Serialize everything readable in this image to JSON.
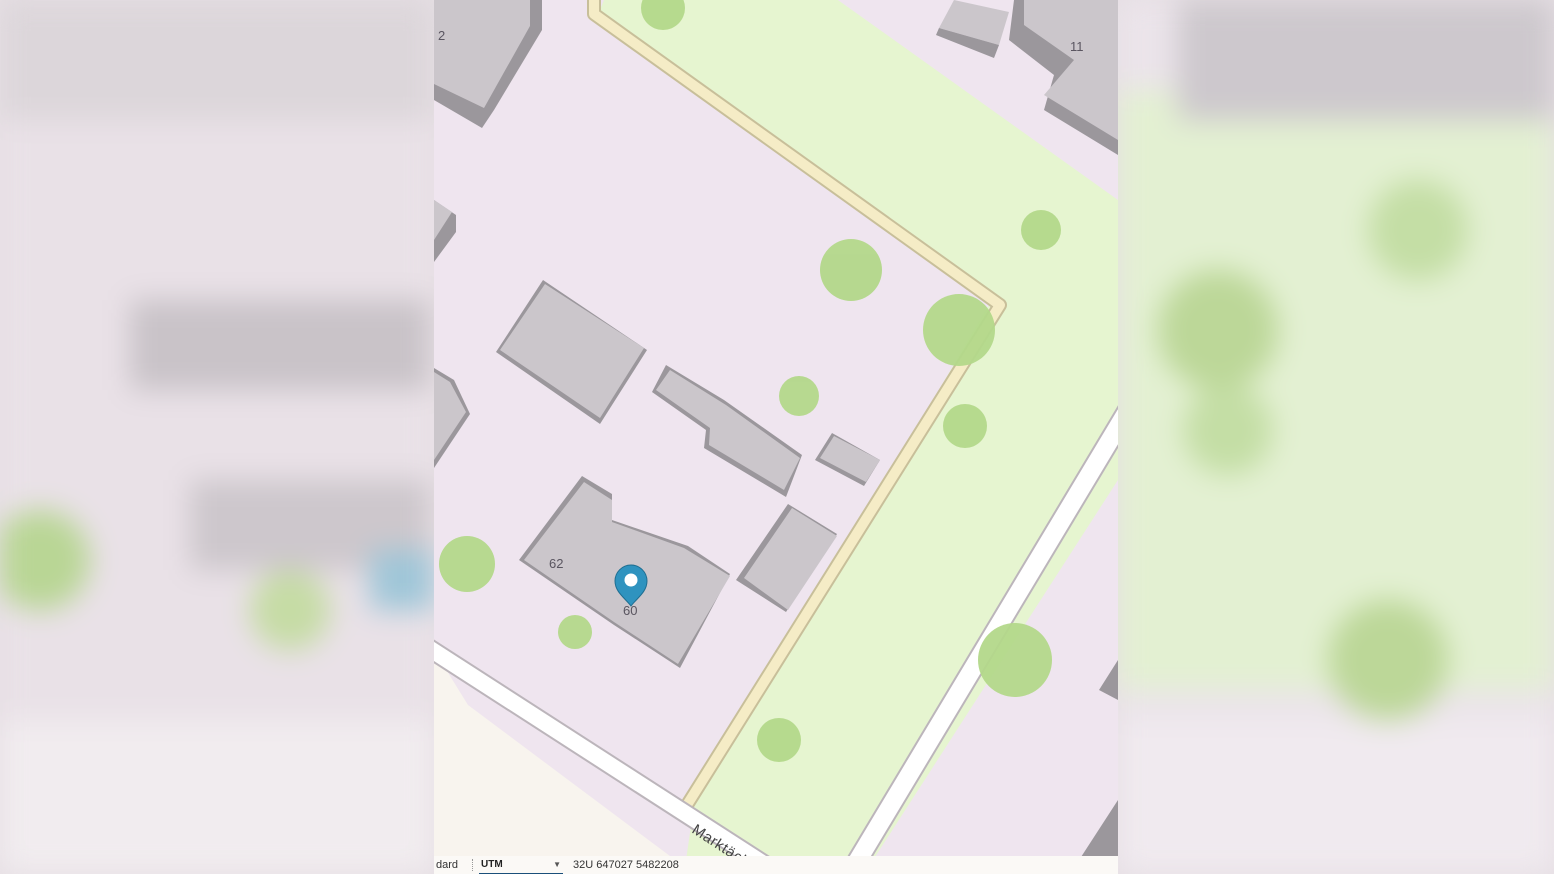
{
  "map": {
    "house_numbers": [
      "2",
      "11",
      "62",
      "60"
    ],
    "street_name": "Marktäcker",
    "marker_icon": "location-pin-icon",
    "colors": {
      "residential": "#efe5ef",
      "park": "#e6f5d0",
      "building": "#cbc6cb",
      "building_side": "#9b979c",
      "tree": "#b3d88a",
      "footway": "#f5ecc6",
      "road": "#ffffff",
      "marker": "#2f93bf"
    }
  },
  "status_bar": {
    "mode_label": "dard",
    "crs_selected": "UTM",
    "coordinates": "32U 647027 5482208"
  }
}
